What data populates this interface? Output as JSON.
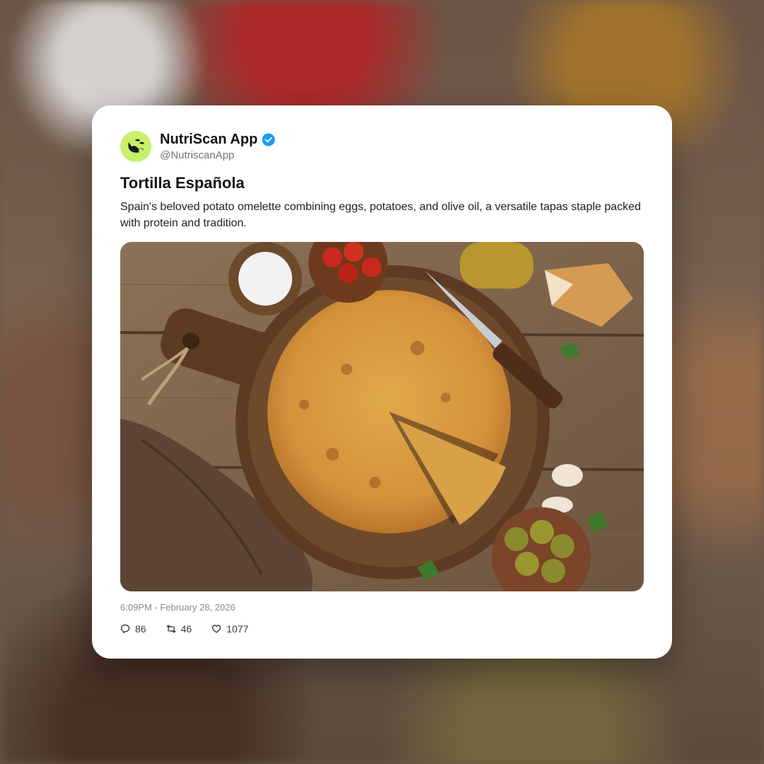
{
  "post": {
    "author": {
      "display_name": "NutriScan App",
      "handle": "@NutriscanApp",
      "verified": true,
      "avatar_color": "#c8f06a",
      "verified_color": "#1d9bf0"
    },
    "title": "Tortilla Española",
    "description": "Spain's beloved potato omelette combining eggs, potatoes, and olive oil, a versatile tapas staple packed with protein and tradition.",
    "image_alt": "Spanish tortilla on a wooden cutting board with a knife, salt, tomatoes, olive oil, bread, garlic, parsley and olives",
    "timestamp": "6:09PM - February 28, 2026",
    "stats": {
      "replies": "86",
      "reposts": "46",
      "likes": "1077"
    }
  },
  "icons": {
    "avatar": "nutriscan-logo-icon",
    "verified": "verified-badge-icon",
    "replies": "comment-icon",
    "reposts": "repost-icon",
    "likes": "heart-icon"
  }
}
